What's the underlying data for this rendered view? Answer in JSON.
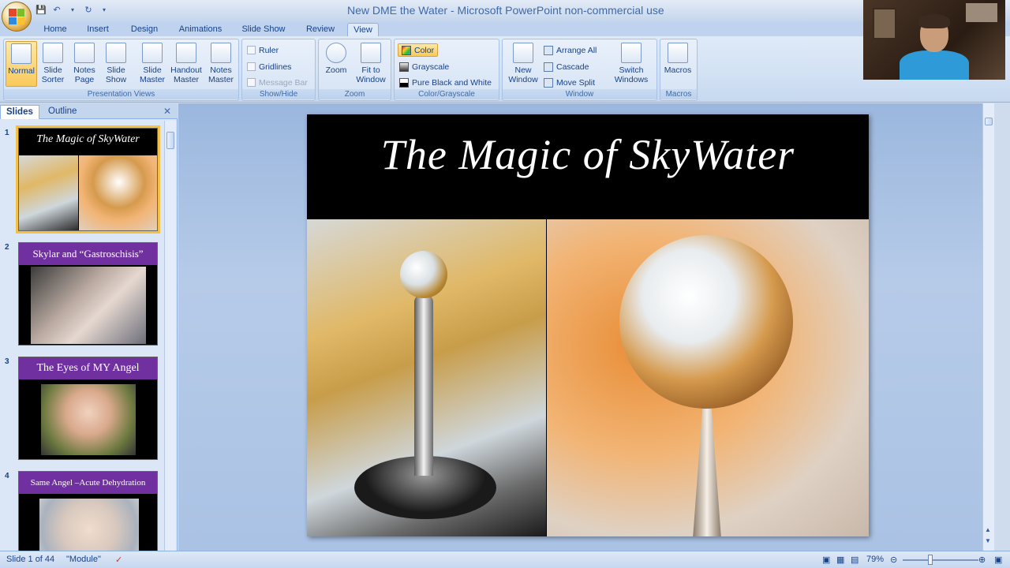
{
  "window": {
    "title": "New DME the Water - Microsoft PowerPoint non-commercial use"
  },
  "quick_access": {
    "save_icon": "save-icon",
    "undo_icon": "undo-icon",
    "redo_icon": "redo-icon",
    "customize_icon": "chevron-down-icon"
  },
  "tabs": [
    "Home",
    "Insert",
    "Design",
    "Animations",
    "Slide Show",
    "Review",
    "View"
  ],
  "active_tab": "View",
  "ribbon": {
    "presentation_views": {
      "label": "Presentation Views",
      "buttons": [
        {
          "label": "Normal",
          "selected": true
        },
        {
          "label": "Slide Sorter"
        },
        {
          "label": "Notes Page"
        },
        {
          "label": "Slide Show"
        },
        {
          "label": "Slide Master"
        },
        {
          "label": "Handout Master"
        },
        {
          "label": "Notes Master"
        }
      ]
    },
    "show_hide": {
      "label": "Show/Hide",
      "ruler": "Ruler",
      "gridlines": "Gridlines",
      "message_bar": "Message Bar"
    },
    "zoom": {
      "label": "Zoom",
      "zoom": "Zoom",
      "fit_to_window": "Fit to Window"
    },
    "color_grayscale": {
      "label": "Color/Grayscale",
      "color": "Color",
      "grayscale": "Grayscale",
      "pure_bw": "Pure Black and White"
    },
    "window": {
      "label": "Window",
      "new_window": "New Window",
      "arrange_all": "Arrange All",
      "cascade": "Cascade",
      "move_split": "Move Split",
      "switch_windows": "Switch Windows"
    },
    "macros": {
      "label": "Macros",
      "macros": "Macros"
    }
  },
  "left_pane": {
    "tabs": [
      "Slides",
      "Outline"
    ],
    "slides": [
      {
        "num": "1",
        "title": "The Magic of SkyWater",
        "title_bg": "#000000"
      },
      {
        "num": "2",
        "title": "Skylar and “Gastroschisis”",
        "title_bg": "#7030a0"
      },
      {
        "num": "3",
        "title": "The Eyes of MY Angel",
        "title_bg": "#7030a0"
      },
      {
        "num": "4",
        "title": "Same Angel –Acute Dehydration",
        "title_bg": "#7030a0"
      }
    ]
  },
  "slide": {
    "title": "The Magic of SkyWater"
  },
  "status": {
    "slide_info": "Slide 1 of 44",
    "theme": "\"Module\"",
    "zoom": "79%"
  }
}
